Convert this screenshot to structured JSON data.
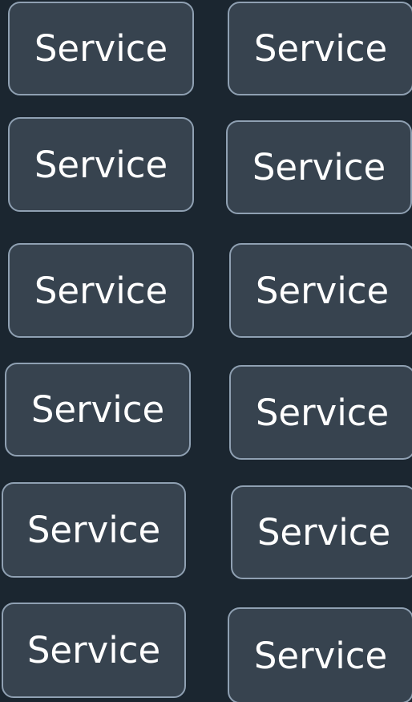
{
  "theme": {
    "background": "#1b2630",
    "button_fill": "#37434f",
    "button_border": "#8fa0b2",
    "button_text": "#ffffff"
  },
  "grid": {
    "buttons": [
      {
        "label": "Service"
      },
      {
        "label": "Service"
      },
      {
        "label": "Service"
      },
      {
        "label": "Service"
      },
      {
        "label": "Service"
      },
      {
        "label": "Service"
      },
      {
        "label": "Service"
      },
      {
        "label": "Service"
      },
      {
        "label": "Service"
      },
      {
        "label": "Service"
      },
      {
        "label": "Service"
      },
      {
        "label": "Service"
      }
    ]
  }
}
